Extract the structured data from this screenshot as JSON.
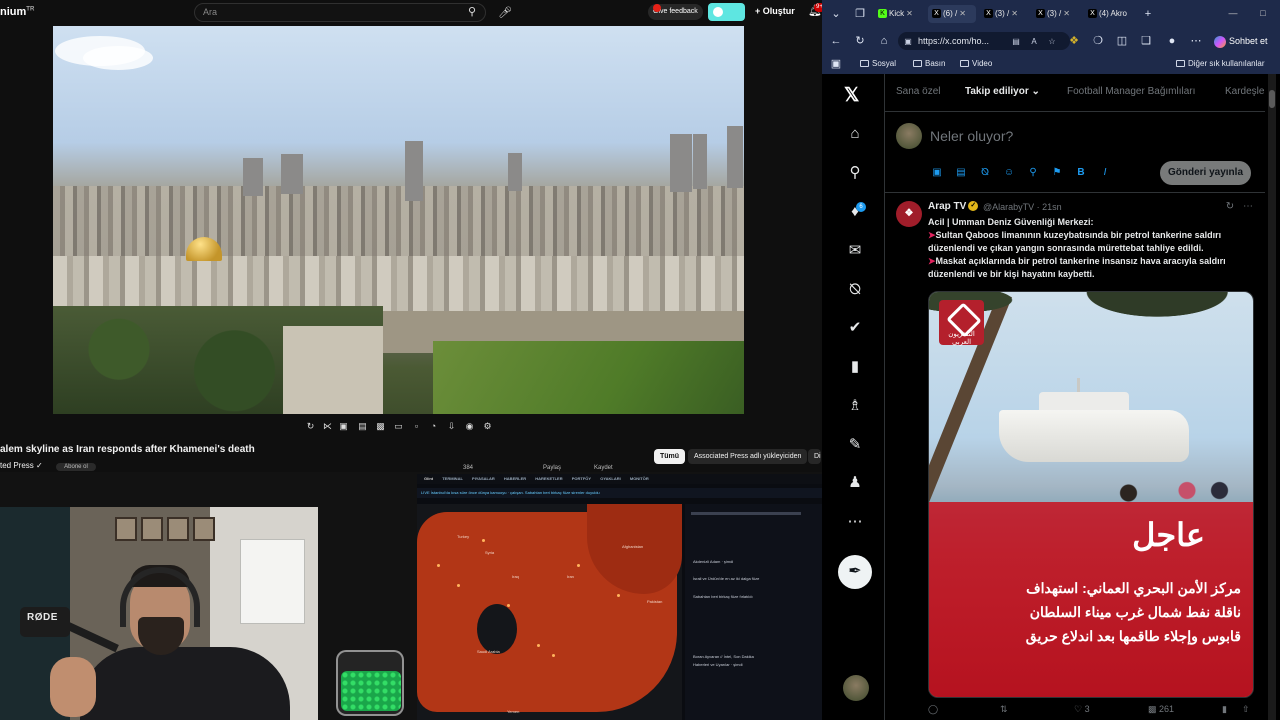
{
  "youtube": {
    "logo": "nium",
    "logo_sup": "TR",
    "search_placeholder": "Ara",
    "feedback_label": "Give feedback",
    "create_label": "Oluştur",
    "notif_count": "9+",
    "video_title": "alem skyline as Iran responds after Khamenei's death",
    "channel_name": "ted Press",
    "subscribe_label": "Abone ol",
    "meta_items": [
      "384",
      "Paylaş",
      "Kaydet"
    ],
    "chips": [
      "Tümü",
      "Associated Press adlı yükleyiciden",
      "Di"
    ]
  },
  "monitor": {
    "brand": "Glint",
    "tabs": [
      "TERMINAL",
      "PIYASALAR",
      "HABERLER",
      "HAREKETLER",
      "PORTFÖY",
      "OYAKLARI",
      "MONITÖR"
    ],
    "ticker": "LIVE  İstanbul'da kısa süre önce dünya kamuoyu  ·  çalışan. Sabahtan beri birkaç füze sirenler duyuldu",
    "map_labels": [
      "Turkey",
      "Syria",
      "Iran",
      "Iraq",
      "Afghanistan",
      "Saudi Arabia",
      "Yemen",
      "Pakistan"
    ],
    "panel_items": [
      "Akdenizli Adam · şimdi",
      "İsrail ve Ürdün'de en az iki dalga füze",
      "Sabahtan beri birkaç füze fırlatıldı",
      "Boran Ayvaran // İntel, Son Dakika",
      "Haberleri ve Uyarılar · şimdi"
    ]
  },
  "webcam": {
    "mic_brand": "RØDE"
  },
  "browser": {
    "tabs": [
      {
        "label": "Kick",
        "icon": "K"
      },
      {
        "label": "(6) /",
        "icon": "X"
      },
      {
        "label": "(3) /",
        "icon": "X"
      },
      {
        "label": "(3) /",
        "icon": "X"
      },
      {
        "label": "(4) Akro",
        "icon": "X"
      }
    ],
    "url": "https://x.com/ho...",
    "copilot_label": "Sohbet et",
    "bookmarks": [
      "Sosyal",
      "Basın",
      "Video",
      "Diğer sık kullanılanlar"
    ]
  },
  "x": {
    "tabs": [
      "Sana özel",
      "Takip ediliyor",
      "Football Manager Bağımlıları",
      "Kardeşle"
    ],
    "compose_placeholder": "Neler oluyor?",
    "post_button": "Gönderi yayınla",
    "notif_badge": "6",
    "tweet": {
      "name": "Arap TV",
      "handle": "@AlarabyTV · 21sn",
      "lines": [
        "Acil | Umman Deniz Güvenliği Merkezi:",
        "Sultan Qaboos limanının kuzeybatısında bir petrol tankerine saldırı",
        "düzenlendi ve çıkan yangın sonrasında mürettebat tahliye edildi.",
        "Maskat açıklarında bir petrol tankerine insansız hava aracıyla saldırı",
        "düzenlendi ve bir kişi hayatını kaybetti."
      ],
      "image_logo_text": "التلفزيون العربي",
      "breaking_title": "عاجل",
      "breaking_lines": [
        "مركز الأمن البحري العماني: استهداف",
        "ناقلة نفط شمال غرب ميناء السلطان",
        "قابوس وإجلاء طاقمها بعد اندلاع حريق"
      ],
      "actions": [
        "",
        "",
        "3",
        "261",
        "",
        ""
      ]
    }
  },
  "colors": {
    "x_blue": "#1d9bf0",
    "breaking_red": "#c41c2a",
    "edge_chrome": "#1e2a4a"
  }
}
